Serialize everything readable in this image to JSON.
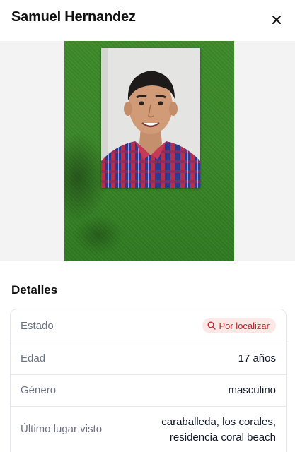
{
  "header": {
    "title": "Samuel Hernandez",
    "close_icon": "close-icon"
  },
  "photo": {
    "icon": "person-photo"
  },
  "details": {
    "section_title": "Detalles",
    "rows": [
      {
        "label": "Estado",
        "badge": "Por localizar",
        "badge_icon": "search-icon"
      },
      {
        "label": "Edad",
        "value": "17 años"
      },
      {
        "label": "Género",
        "value": "masculino"
      },
      {
        "label": "Último lugar visto",
        "value_line1": "caraballeda, los corales,",
        "value_line2": "residencia coral beach"
      }
    ]
  },
  "colors": {
    "badge_bg": "#fde8e8",
    "badge_text": "#c0262d"
  }
}
